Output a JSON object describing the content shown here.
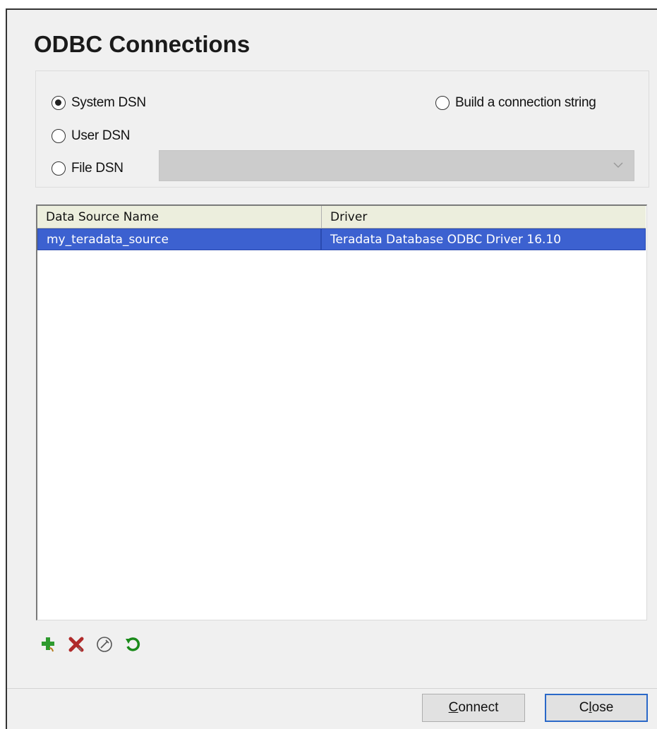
{
  "dialog": {
    "title": "ODBC Connections"
  },
  "dsn_options": {
    "system": {
      "label": "System DSN",
      "checked": true
    },
    "user": {
      "label": "User DSN",
      "checked": false
    },
    "file": {
      "label": "File DSN",
      "checked": false
    },
    "build": {
      "label": "Build a connection string",
      "checked": false
    }
  },
  "file_dsn_combo": {
    "value": ""
  },
  "table": {
    "columns": [
      "Data Source Name",
      "Driver"
    ],
    "rows": [
      {
        "name": "my_teradata_source",
        "driver": "Teradata Database ODBC Driver 16.10",
        "selected": true
      }
    ]
  },
  "toolbar": {
    "icons": [
      "add-icon",
      "delete-icon",
      "edit-icon",
      "refresh-icon"
    ]
  },
  "buttons": {
    "connect_mnemonic": "C",
    "connect_rest": "onnect",
    "close_prefix": "C",
    "close_mnemonic": "l",
    "close_rest": "ose"
  },
  "colors": {
    "selection": "#3c61d0",
    "header_bg": "#eceedd",
    "dialog_bg": "#f0f0f0",
    "default_button_border": "#2a68c8",
    "add_icon": "#2e9a2e",
    "delete_icon": "#b02a2a",
    "refresh_icon": "#1a8a1a"
  }
}
